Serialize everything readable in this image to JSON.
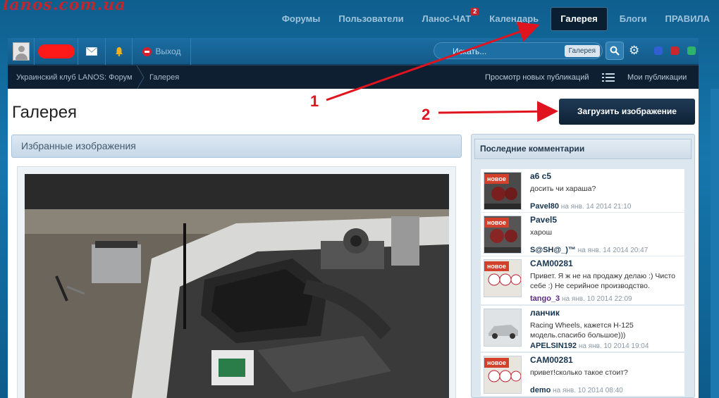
{
  "logo": {
    "text": "lanos.com.ua"
  },
  "main_nav": [
    {
      "label": "Форумы",
      "active": false
    },
    {
      "label": "Пользователи",
      "active": false
    },
    {
      "label": "Ланос-ЧАТ",
      "active": false,
      "badge": "2"
    },
    {
      "label": "Календарь",
      "active": false
    },
    {
      "label": "Галерея",
      "active": true
    },
    {
      "label": "Блоги",
      "active": false
    },
    {
      "label": "ПРАВИЛА",
      "active": false
    }
  ],
  "user_bar": {
    "logout_label": "Выход",
    "search_placeholder": "Искать...",
    "search_scope": "Галерея",
    "style_colors": [
      "#2f5fd0",
      "#c9272d",
      "#2fb36a"
    ]
  },
  "breadcrumb": {
    "items": [
      "Украинский клуб LANOS: Форум",
      "Галерея"
    ],
    "new_posts": "Просмотр новых публикаций",
    "my_posts": "Мои публикации"
  },
  "page": {
    "title": "Галерея",
    "upload_button": "Загрузить изображение",
    "featured_header": "Избранные изображения"
  },
  "annotations": {
    "label_1": "1",
    "label_2": "2",
    "arrow_color": "#e0141e"
  },
  "sidebar": {
    "header": "Последние комментарии",
    "badge": "новое",
    "comments": [
      {
        "title": "а6 с5",
        "text": "досить чи хараша?",
        "user": "Pavel80",
        "date": "на янв. 14 2014 21:10"
      },
      {
        "title": "Pavel5",
        "text": "харош",
        "user": "S@SH@_)™",
        "date": "на янв. 14 2014 20:47"
      },
      {
        "title": "CAM00281",
        "text": "Привет. Я ж не на продажу делаю :) Чисто себе :) Не серийное производство.",
        "user": "tango_3",
        "date": "на янв. 10 2014 22:09"
      },
      {
        "title": "ланчик",
        "text": "Racing Wheels, кажется Н-125 модель.спасибо большое)))",
        "user": "APELSIN192",
        "date": "на янв. 10 2014 19:04"
      },
      {
        "title": "CAM00281",
        "text": "привет!сколько такое стоит?",
        "user": "demo",
        "date": "на янв. 10 2014 08:40"
      }
    ]
  }
}
